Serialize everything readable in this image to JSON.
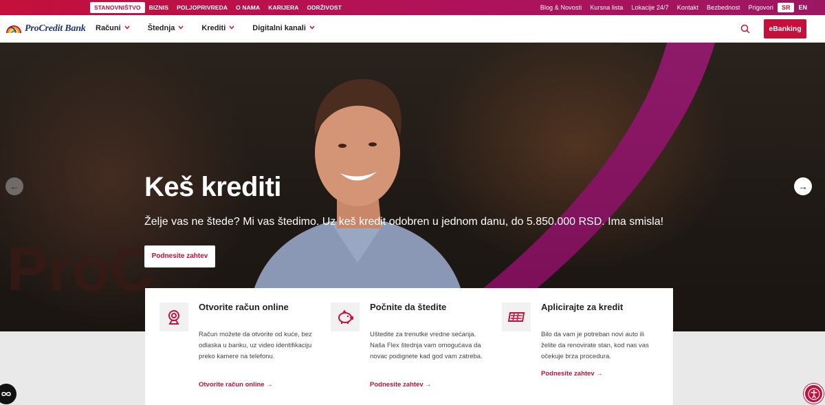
{
  "topbar": {
    "segments": [
      "STANOVNIŠTVO",
      "BIZNIS",
      "POLJOPRIVREDA",
      "O NAMA",
      "KARIJERA",
      "ODRŽIVOST"
    ],
    "links": [
      "Blog & Novosti",
      "Kursna lista",
      "Lokacije 24/7",
      "Kontakt",
      "Bezbednost",
      "Prigovori"
    ],
    "lang_active": "SR",
    "lang_other": "EN"
  },
  "navbar": {
    "logo_text": "ProCredit Bank",
    "menu": [
      "Računi",
      "Štednja",
      "Krediti",
      "Digitalni kanali"
    ],
    "chevron": "⌄",
    "ebanking_label": "eBanking"
  },
  "hero": {
    "title": "Keš krediti",
    "subtitle": "Želje vas ne štede? Mi vas štedimo. Uz keš kredit odobren u jednom danu, do 5.850.000 RSD. Ima smisla!",
    "cta_label": "Podnesite zahtev",
    "arrow_left": "←",
    "arrow_right": "→"
  },
  "cards": [
    {
      "title": "Otvorite račun online",
      "text": "Račun možete da otvorite od kuće, bez odlaska u banku, uz video identifikaciju preko kamere na telefonu.",
      "link": "Otvorite račun online",
      "icon": "webcam-icon"
    },
    {
      "title": "Počnite da štedite",
      "text": "Uštedite za trenutke vredne sećanja. Naša Flex štednja vam omogućava da novac podignete kad god vam zatreba.",
      "link": "Podnesite zahtev",
      "icon": "piggy-bank-icon"
    },
    {
      "title": "Aplicirajte za kredit",
      "text": "Bilo da vam je potreban novi auto ili želite da renovirate stan, kod nas vas očekuje brza procedura.",
      "link": "Podnesite zahtev",
      "icon": "banknotes-icon"
    }
  ],
  "colors": {
    "brand_red": "#c4103b",
    "brand_magenta": "#9c1762",
    "logo_blue": "#20366e"
  }
}
